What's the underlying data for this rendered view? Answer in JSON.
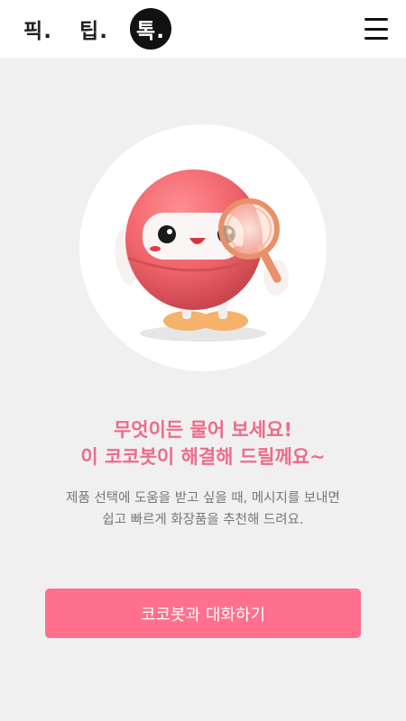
{
  "header": {
    "tabs": [
      {
        "label": "픽.",
        "active": false
      },
      {
        "label": "팁.",
        "active": false
      },
      {
        "label": "톡.",
        "active": true
      }
    ],
    "menu_icon": "hamburger-menu-icon"
  },
  "hero": {
    "illustration": "kokobot-mascot-with-magnifying-glass"
  },
  "main": {
    "headline_line1": "무엇이든 물어 보세요!",
    "headline_line2": "이 코코봇이 해결해 드릴께요~",
    "description_line1": "제품 선택에 도움을 받고 싶을 때, 메시지를 보내면",
    "description_line2": "쉽고 빠르게 화장품을 추천해 드려요."
  },
  "cta": {
    "label": "코코봇과 대화하기"
  },
  "colors": {
    "accent": "#ff6f8e",
    "headline": "#ee6b8a",
    "background": "#f0f0f0",
    "active_tab": "#111111"
  }
}
